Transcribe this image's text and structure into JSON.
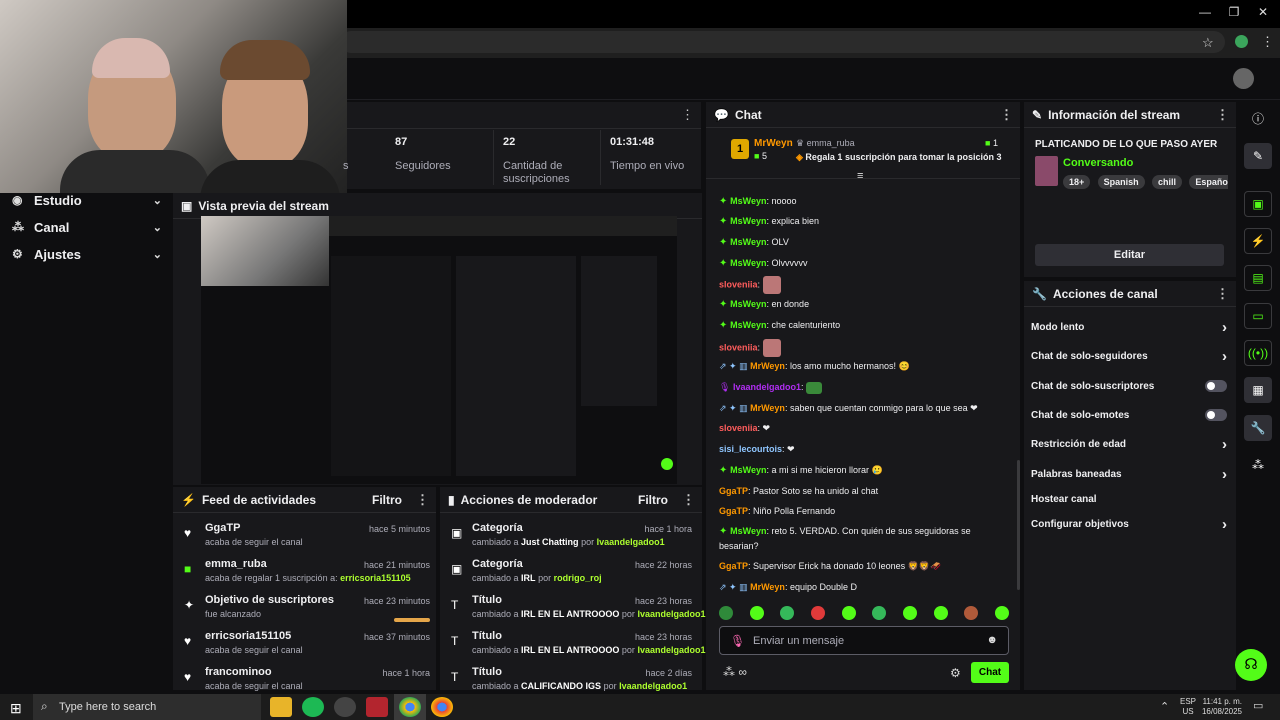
{
  "window": {
    "min": "—",
    "restore": "❐",
    "close": "✕"
  },
  "nav": [
    {
      "label": "Estudio"
    },
    {
      "label": "Canal"
    },
    {
      "label": "Ajustes"
    }
  ],
  "stats": [
    {
      "value": "87",
      "label": "Seguidores"
    },
    {
      "value": "22",
      "label": "Cantidad de suscripciones"
    },
    {
      "value": "01:31:48",
      "label": "Tiempo en vivo"
    }
  ],
  "stats_partial_label": "s",
  "preview": {
    "title": "Vista previa del stream"
  },
  "feed": {
    "title": "Feed de actividades",
    "filter": "Filtro",
    "items": [
      {
        "icon": "heart-icon",
        "glyph": "♥",
        "title": "GgaTP",
        "time": "hace 5 minutos",
        "sub": "acaba de seguir el canal",
        "hl": ""
      },
      {
        "icon": "gift-icon",
        "glyph": "■",
        "title": "emma_ruba",
        "time": "hace 21 minutos",
        "sub": "acaba de regalar 1 suscripción a:",
        "hl": "erricsoria151105"
      },
      {
        "icon": "sparkle-icon",
        "glyph": "✦",
        "title": "Objetivo de suscriptores",
        "time": "hace 23 minutos",
        "sub": "fue alcanzado",
        "hl": ""
      },
      {
        "icon": "heart-icon",
        "glyph": "♥",
        "title": "erricsoria151105",
        "time": "hace 37 minutos",
        "sub": "acaba de seguir el canal",
        "hl": ""
      },
      {
        "icon": "heart-icon",
        "glyph": "♥",
        "title": "francominoo",
        "time": "hace 1 hora",
        "sub": "acaba de seguir el canal",
        "hl": ""
      }
    ]
  },
  "mod": {
    "title": "Acciones de moderador",
    "filter": "Filtro",
    "items": [
      {
        "title": "Categoría",
        "time": "hace 1 hora",
        "pre": "cambiado a",
        "val": "Just Chatting",
        "por": "por",
        "who": "Ivaandelgadoo1"
      },
      {
        "title": "Categoría",
        "time": "hace 22 horas",
        "pre": "cambiado a",
        "val": "IRL",
        "por": "por",
        "who": "rodrigo_roj"
      },
      {
        "title": "Título",
        "time": "hace 23 horas",
        "pre": "cambiado a",
        "val": "IRL EN EL ANTROOOO",
        "por": "por",
        "who": "Ivaandelgadoo1"
      },
      {
        "title": "Título",
        "time": "hace 23 horas",
        "pre": "cambiado a",
        "val": "IRL EN EL ANTROOOO",
        "por": "por",
        "who": "Ivaandelgadoo1"
      },
      {
        "title": "Título",
        "time": "hace 2 días",
        "pre": "cambiado a",
        "val": "CALIFICANDO IGS",
        "por": "por",
        "who": "Ivaandelgadoo1"
      }
    ]
  },
  "chat": {
    "title": "Chat",
    "pinned": {
      "rank": "1",
      "user": "MrWeyn",
      "count": "5",
      "gifter": "emma_ruba",
      "gift_count": "1",
      "text": "Regala 1 suscripción para tomar la posición 3"
    },
    "lines": [
      {
        "user": "MsWeyn",
        "cls": "green",
        "text": "noooo"
      },
      {
        "user": "MsWeyn",
        "cls": "green",
        "text": "explica bien"
      },
      {
        "user": "MsWeyn",
        "cls": "green",
        "text": "OLV"
      },
      {
        "user": "MsWeyn",
        "cls": "green",
        "text": "Olvvvvvv"
      },
      {
        "user": "sloveniia",
        "cls": "",
        "text": ""
      },
      {
        "user": "MsWeyn",
        "cls": "green",
        "text": "en donde"
      },
      {
        "user": "MsWeyn",
        "cls": "green",
        "text": "che calenturiento"
      },
      {
        "user": "sloveniia",
        "cls": "",
        "text": ""
      },
      {
        "user": "MrWeyn",
        "cls": "orange",
        "text": "los amo mucho hermanos! 😊"
      },
      {
        "user": "Ivaandelgadoo1",
        "cls": "purple",
        "text": ""
      },
      {
        "user": "MrWeyn",
        "cls": "orange",
        "text": "saben que cuentan conmigo para lo que sea ❤"
      },
      {
        "user": "sloveniia",
        "cls": "",
        "text": "❤"
      },
      {
        "user": "sisi_lecourtois",
        "cls": "blue",
        "text": "❤"
      },
      {
        "user": "MsWeyn",
        "cls": "green",
        "text": "a mi si me hicieron llorar 🥲"
      },
      {
        "user": "GgaTP",
        "cls": "orange",
        "text": "Pastor Soto se ha unido al chat"
      },
      {
        "user": "GgaTP",
        "cls": "orange",
        "text": "Niño Polla Fernando"
      },
      {
        "user": "MsWeyn",
        "cls": "green",
        "text": "reto 5. VERDAD. Con quién de sus seguidoras se besarian?"
      },
      {
        "user": "GgaTP",
        "cls": "orange",
        "text": "Supervisor Erick ha donado 10 leones 🦁🦁🛷"
      },
      {
        "user": "MrWeyn",
        "cls": "orange",
        "text": "equipo Double D"
      }
    ],
    "placeholder": "Enviar un mensaje",
    "send": "Chat"
  },
  "stream_info": {
    "title": "Información del stream",
    "stream_title": "PLATICANDO DE LO QUE PASO AYER",
    "category": "Conversando",
    "tags": [
      "18+",
      "Spanish",
      "chill",
      "Español"
    ],
    "edit": "Editar"
  },
  "channel_actions": {
    "title": "Acciones de canal",
    "items": [
      {
        "label": "Modo lento",
        "kind": "chevron"
      },
      {
        "label": "Chat de solo-seguidores",
        "kind": "chevron"
      },
      {
        "label": "Chat de solo-suscriptores",
        "kind": "toggle"
      },
      {
        "label": "Chat de solo-emotes",
        "kind": "toggle"
      },
      {
        "label": "Restricción de edad",
        "kind": "chevron"
      },
      {
        "label": "Palabras baneadas",
        "kind": "chevron"
      },
      {
        "label": "Hostear canal",
        "kind": "none"
      },
      {
        "label": "Configurar objetivos",
        "kind": "chevron"
      }
    ]
  },
  "taskbar": {
    "search": "Type here to search",
    "lang1": "ESP",
    "lang2": "US",
    "time": "11:41 p. m.",
    "date": "16/08/2025"
  },
  "colors": {
    "accent": "#53fc18",
    "panel": "#18181b",
    "bg": "#0e0e10"
  }
}
